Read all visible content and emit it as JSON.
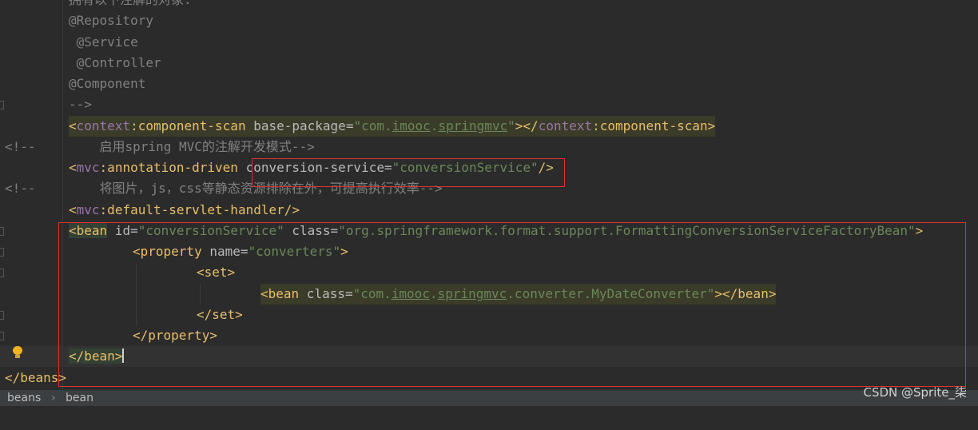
{
  "editor": {
    "comment_partial_top": "拥有以下注解的对象:",
    "ann_repository": "@Repository",
    "ann_service": " @Service",
    "ann_controller": " @Controller",
    "ann_component": "@Component",
    "comment_end": "-->",
    "scan_open": "<",
    "scan_ns": "context",
    "scan_name": ":component-scan",
    "scan_attr": " base-package",
    "scan_eq": "=",
    "scan_val_a": "\"com.",
    "scan_val_b": "imooc",
    "scan_val_c": ".",
    "scan_val_d": "springmvc",
    "scan_val_e": "\"",
    "scan_close_a": "></",
    "scan_close_ns": "context",
    "scan_close_b": ":component-scan>",
    "gutter_comment_1": "<!--",
    "comment_mvc": "    启用spring MVC的注解开发模式-->",
    "mvc_open": "<",
    "mvc_ns": "mvc",
    "mvc_name": ":annotation-driven",
    "mvc_attr": " conversion-service",
    "mvc_eq": "=",
    "mvc_val": "\"conversionService\"",
    "mvc_close": "/>",
    "gutter_comment_2": "<!--",
    "comment_static": "    将图片，js，css等静态资源排除在外，可提高执行效率-->",
    "servlet_open": "<",
    "servlet_ns": "mvc",
    "servlet_name": ":default-servlet-handler/>",
    "bean_open_tag": "<bean",
    "bean_id_attr": " id",
    "bean_id_val": "\"conversionService\"",
    "bean_class_attr": " class",
    "bean_class_val": "\"org.springframework.format.support.FormattingConversionServiceFactoryBean\"",
    "bean_gt": ">",
    "prop_open": "<property",
    "prop_name_attr": " name",
    "prop_name_val": "\"converters\"",
    "prop_gt": ">",
    "set_open": "<set>",
    "inner_bean_open": "<bean",
    "inner_class_attr": " class",
    "inner_val_a": "\"com.",
    "inner_val_b": "imooc",
    "inner_val_c": ".",
    "inner_val_d": "springmvc",
    "inner_val_e": ".converter.MyDateConverter\"",
    "inner_close": "></bean>",
    "set_close": "</set>",
    "prop_close": "</property>",
    "bean_close": "</bean>",
    "beans_close": "</beans>",
    "eq": "="
  },
  "statusbar": {
    "crumb_1": "beans",
    "separator": "›",
    "crumb_2": "bean"
  },
  "watermark": "CSDN @Sprite_柒"
}
